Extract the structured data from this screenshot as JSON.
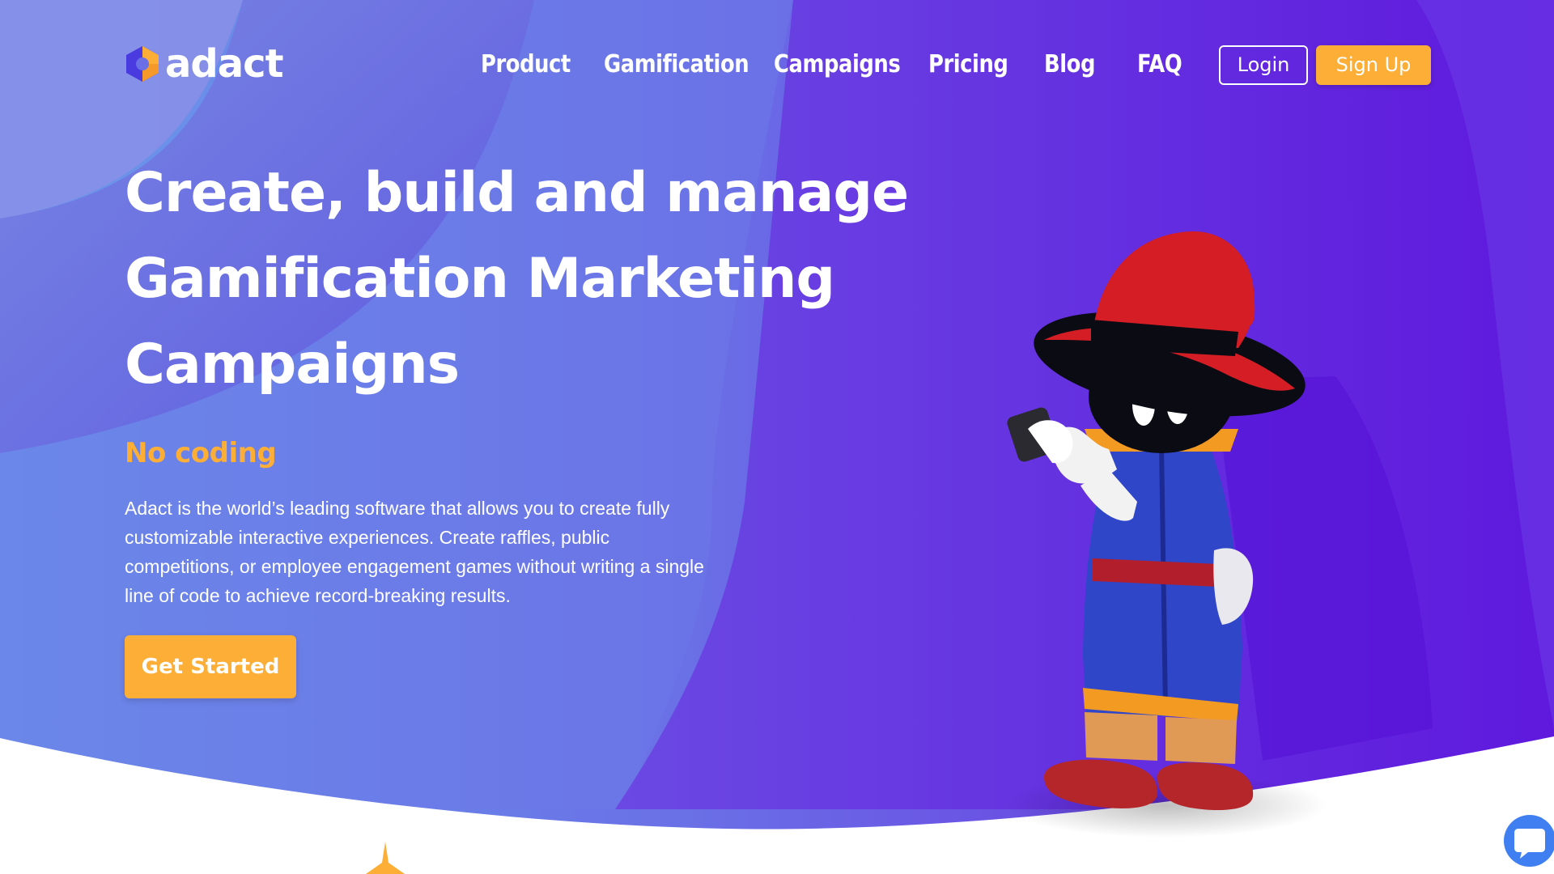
{
  "brand": {
    "name": "adact",
    "accent": "#fcae37",
    "logo_icon": "hexagon-logo-icon"
  },
  "nav": {
    "items": [
      {
        "label": "Product"
      },
      {
        "label": "Gamification"
      },
      {
        "label": "Campaigns"
      },
      {
        "label": "Pricing"
      },
      {
        "label": "Blog"
      },
      {
        "label": "FAQ"
      }
    ],
    "login_label": "Login",
    "signup_label": "Sign Up"
  },
  "hero": {
    "headline_lines": [
      "Create, build and manage",
      "Gamification Marketing",
      "Campaigns"
    ],
    "tagline": "No coding",
    "description": "Adact is the world’s leading software that allows you to create fully customizable interactive experiences. Create raffles, public competitions, or employee engagement games without writing a single line of code to achieve record-breaking results.",
    "cta_label": "Get Started",
    "illustration": "wizard-mascot-illustration"
  },
  "colors": {
    "gradient_left": "#6a8fe8",
    "gradient_right": "#6a1fe0",
    "text": "#ffffff"
  },
  "widgets": {
    "chat_icon": "chat-bubble-icon"
  }
}
